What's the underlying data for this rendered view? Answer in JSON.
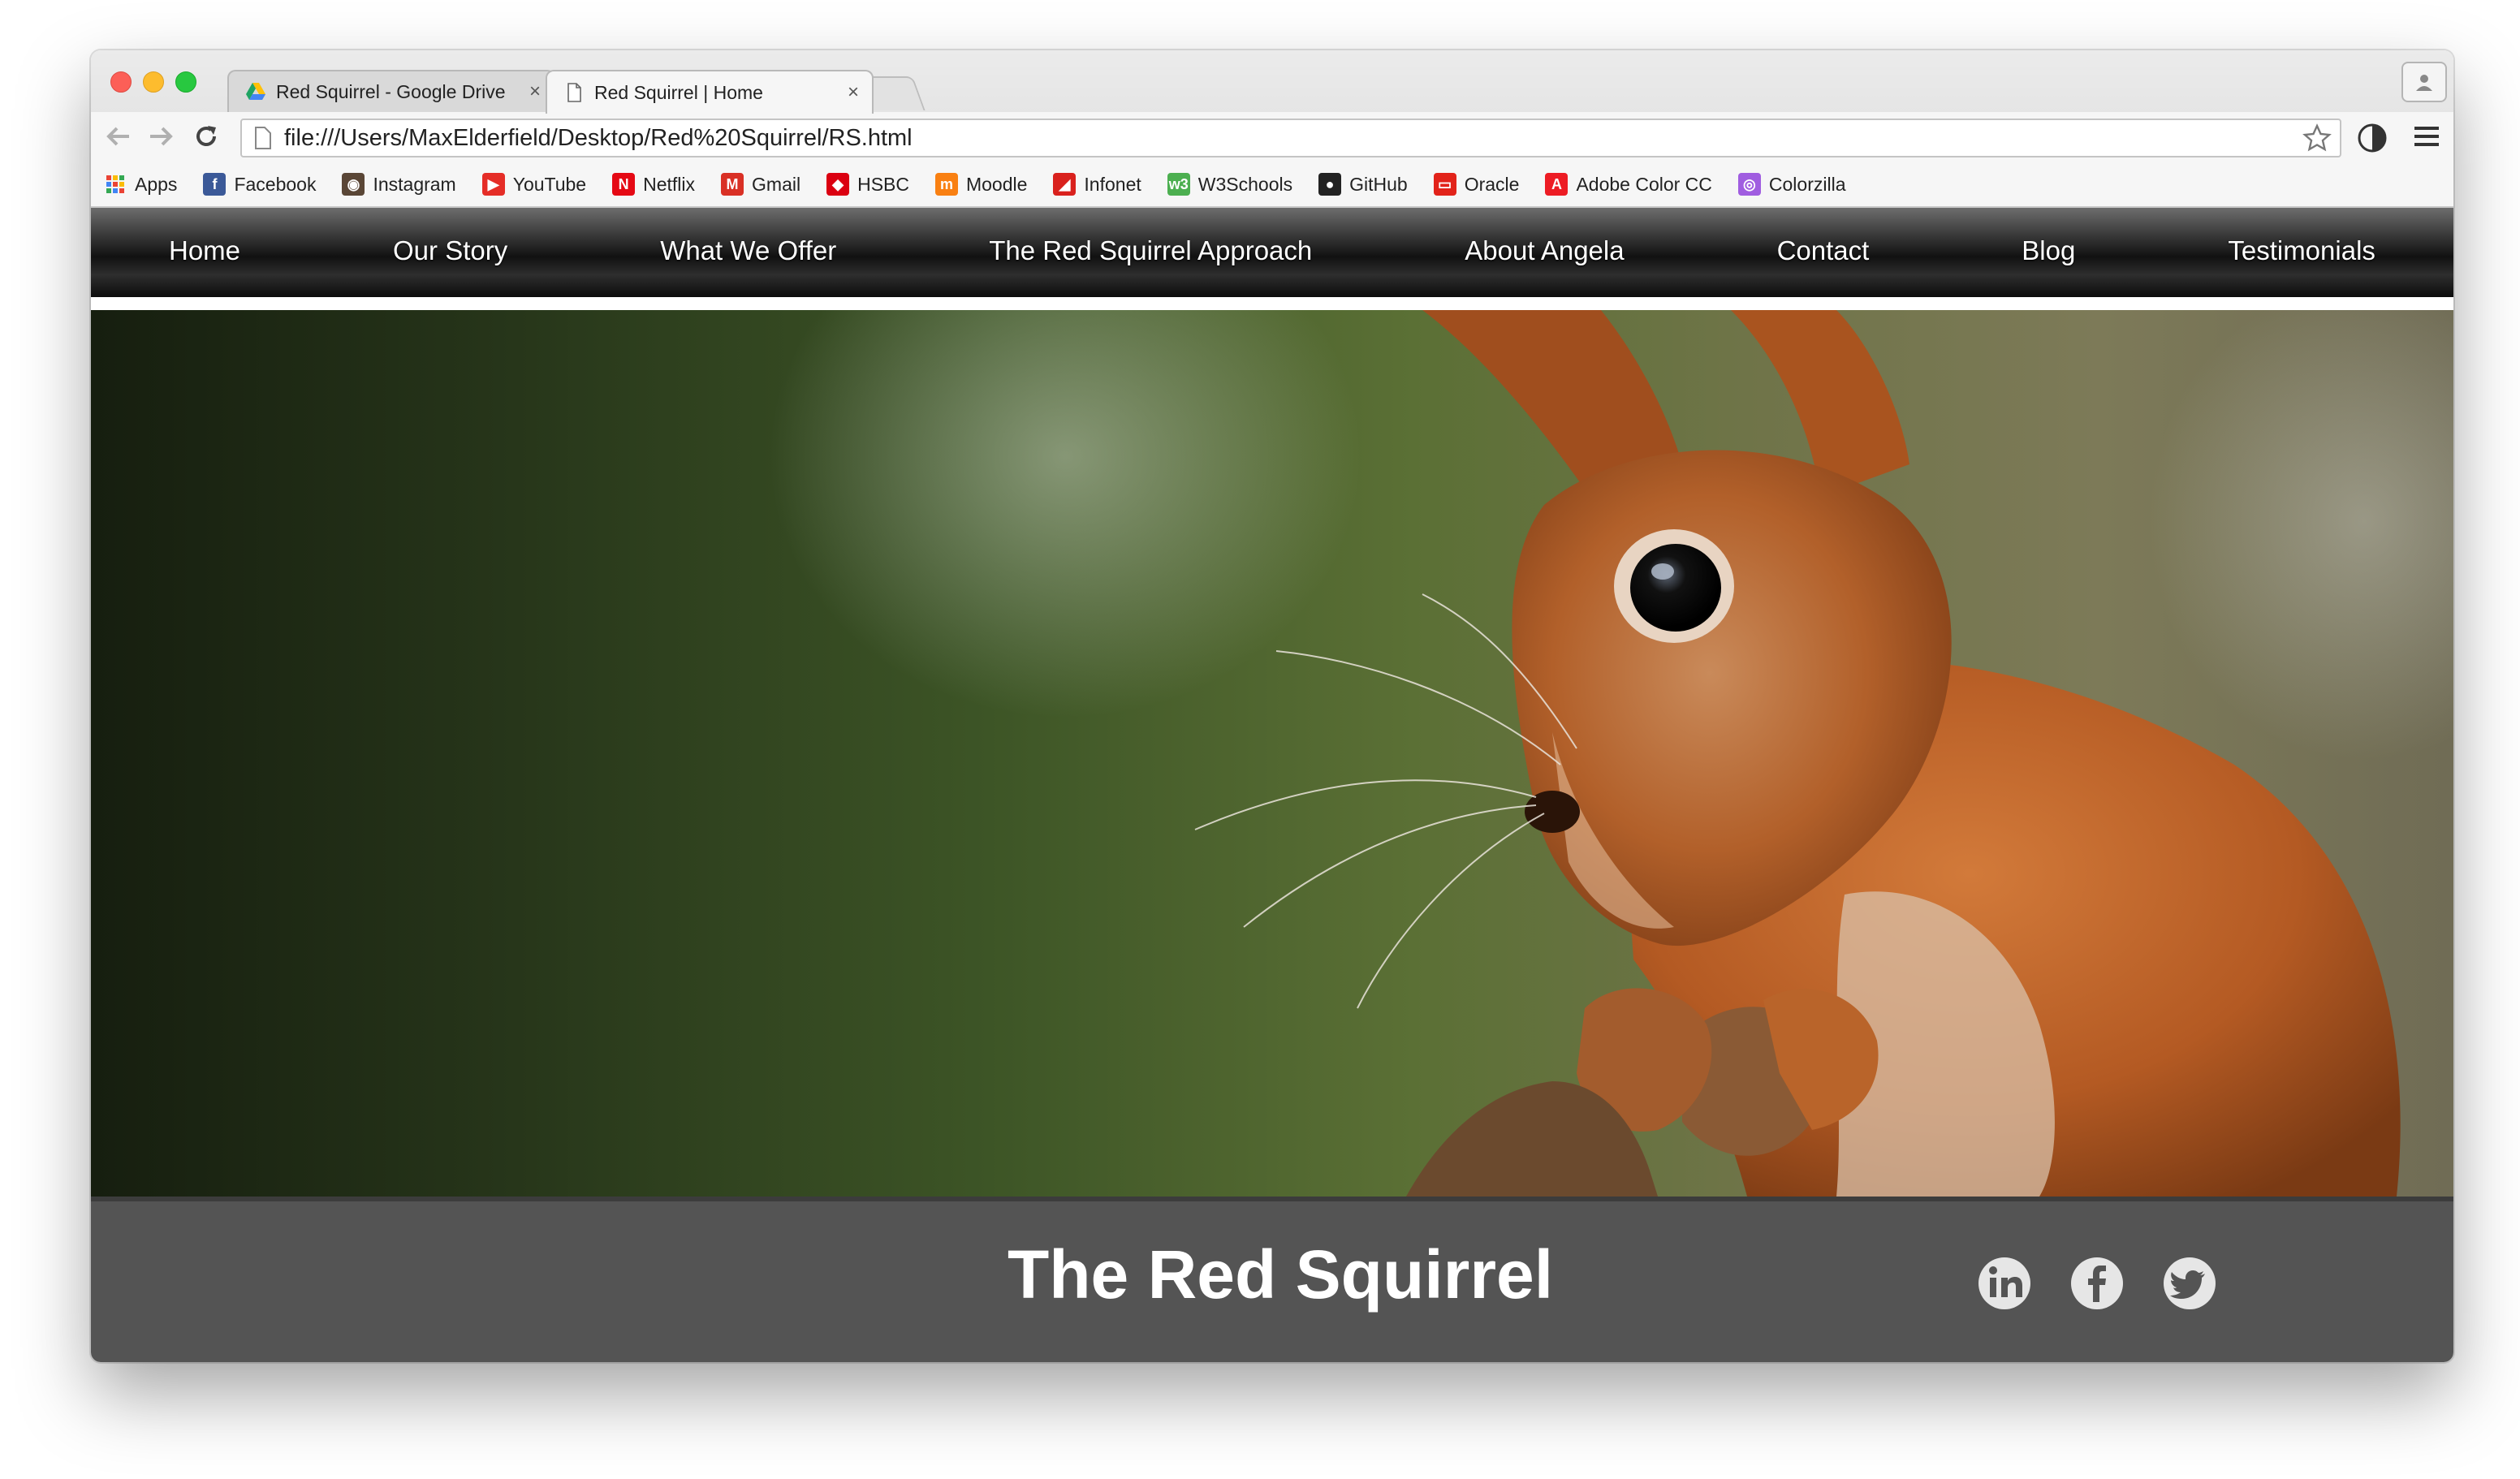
{
  "browser": {
    "tabs": [
      {
        "title": "Red Squirrel - Google Drive",
        "close": "×"
      },
      {
        "title": "Red Squirrel | Home",
        "close": "×"
      }
    ],
    "url": "file:///Users/MaxElderfield/Desktop/Red%20Squirrel/RS.html",
    "bookmarks": [
      {
        "label": "Apps",
        "icon": "apps-grid-icon"
      },
      {
        "label": "Facebook",
        "icon": "facebook-icon",
        "color": "#3b5998",
        "glyph": "f"
      },
      {
        "label": "Instagram",
        "icon": "instagram-icon",
        "color": "#5a4636",
        "glyph": "◉"
      },
      {
        "label": "YouTube",
        "icon": "youtube-icon",
        "color": "#e52d27",
        "glyph": "▶"
      },
      {
        "label": "Netflix",
        "icon": "netflix-icon",
        "color": "#e50914",
        "glyph": "N"
      },
      {
        "label": "Gmail",
        "icon": "gmail-icon",
        "color": "#d93025",
        "glyph": "M"
      },
      {
        "label": "HSBC",
        "icon": "hsbc-icon",
        "color": "#db0011",
        "glyph": "◆"
      },
      {
        "label": "Moodle",
        "icon": "moodle-icon",
        "color": "#f98012",
        "glyph": "m"
      },
      {
        "label": "Infonet",
        "icon": "infonet-icon",
        "color": "#d9211d",
        "glyph": "◢"
      },
      {
        "label": "W3Schools",
        "icon": "w3schools-icon",
        "color": "#4caf50",
        "glyph": "w3"
      },
      {
        "label": "GitHub",
        "icon": "github-icon",
        "color": "#222222",
        "glyph": "●"
      },
      {
        "label": "Oracle",
        "icon": "oracle-icon",
        "color": "#e2231a",
        "glyph": "▭"
      },
      {
        "label": "Adobe Color CC",
        "icon": "adobe-icon",
        "color": "#ed1c24",
        "glyph": "A"
      },
      {
        "label": "Colorzilla",
        "icon": "colorzilla-icon",
        "color": "#a05de0",
        "glyph": "◎"
      }
    ]
  },
  "site": {
    "nav": [
      "Home",
      "Our Story",
      "What We Offer",
      "The Red Squirrel Approach",
      "About Angela",
      "Contact",
      "Blog",
      "Testimonials"
    ],
    "brand_title": "The Red Squirrel",
    "social": [
      {
        "name": "linkedin-icon",
        "glyph": "in"
      },
      {
        "name": "facebook-icon",
        "glyph": "f"
      },
      {
        "name": "twitter-icon",
        "glyph": "bird"
      }
    ]
  },
  "colors": {
    "nav_bg": "#111111",
    "footer_bg": "#545454",
    "brand_text": "#ffffff"
  }
}
